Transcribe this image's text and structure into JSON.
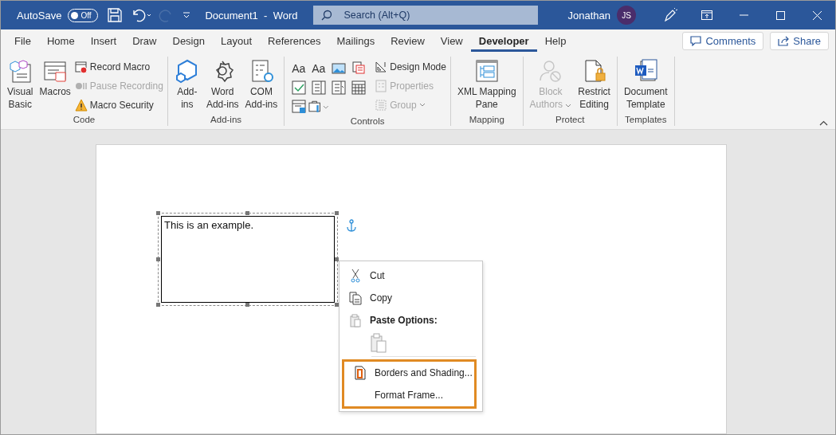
{
  "title_bar": {
    "autosave_label": "AutoSave",
    "autosave_toggle": {
      "label": "Off",
      "on": false
    },
    "document_title": "Document1  -  Word",
    "search": {
      "placeholder": "Search (Alt+Q)"
    },
    "user_name": "Jonathan",
    "avatar_initials": "JS"
  },
  "tabs": [
    {
      "label": "File",
      "selected": false
    },
    {
      "label": "Home",
      "selected": false
    },
    {
      "label": "Insert",
      "selected": false
    },
    {
      "label": "Draw",
      "selected": false
    },
    {
      "label": "Design",
      "selected": false
    },
    {
      "label": "Layout",
      "selected": false
    },
    {
      "label": "References",
      "selected": false
    },
    {
      "label": "Mailings",
      "selected": false
    },
    {
      "label": "Review",
      "selected": false
    },
    {
      "label": "View",
      "selected": false
    },
    {
      "label": "Developer",
      "selected": true
    },
    {
      "label": "Help",
      "selected": false
    }
  ],
  "header_buttons": [
    {
      "label": "Comments"
    },
    {
      "label": "Share"
    }
  ],
  "ribbon_groups": [
    {
      "label": "Code",
      "items": [
        {
          "kind": "large",
          "lines": [
            "Visual",
            "Basic"
          ],
          "disabled": false
        },
        {
          "kind": "large",
          "lines": [
            "Macros"
          ],
          "disabled": false
        },
        {
          "kind": "stack",
          "children": [
            {
              "label": "Record Macro",
              "disabled": false
            },
            {
              "label": "Pause Recording",
              "disabled": true
            },
            {
              "label": "Macro Security",
              "disabled": false
            }
          ]
        }
      ]
    },
    {
      "label": "Add-ins",
      "items": [
        {
          "kind": "large",
          "lines": [
            "Add-",
            "ins"
          ],
          "disabled": false
        },
        {
          "kind": "large",
          "lines": [
            "Word",
            "Add-ins"
          ],
          "disabled": false
        },
        {
          "kind": "large",
          "lines": [
            "COM",
            "Add-ins"
          ],
          "disabled": false
        }
      ]
    },
    {
      "label": "Controls",
      "items": [
        {
          "kind": "grid",
          "cells": [
            {
              "kind": "glyph",
              "glyph": "Aa"
            },
            {
              "kind": "glyph",
              "glyph": "Aa"
            },
            {
              "kind": "icon"
            },
            {
              "kind": "icon"
            },
            {
              "kind": "icon"
            },
            {
              "kind": "icon"
            },
            {
              "kind": "icon"
            },
            {
              "kind": "icon"
            },
            {
              "kind": "icon"
            },
            {
              "kind": "icon",
              "has_menu": true
            }
          ]
        },
        {
          "kind": "stack",
          "children": [
            {
              "label": "Design Mode",
              "disabled": false
            },
            {
              "label": "Properties",
              "disabled": true
            },
            {
              "label": "Group",
              "disabled": true,
              "has_menu": true
            }
          ]
        }
      ]
    },
    {
      "label": "Mapping",
      "items": [
        {
          "kind": "large",
          "lines": [
            "XML Mapping",
            "Pane"
          ],
          "disabled": false
        }
      ]
    },
    {
      "label": "Protect",
      "items": [
        {
          "kind": "large",
          "lines": [
            "Block",
            "Authors"
          ],
          "disabled": true,
          "has_menu": true
        },
        {
          "kind": "large",
          "lines": [
            "Restrict",
            "Editing"
          ],
          "disabled": false
        }
      ]
    },
    {
      "label": "Templates",
      "items": [
        {
          "kind": "large",
          "lines": [
            "Document",
            "Template"
          ],
          "disabled": false
        }
      ]
    }
  ],
  "document": {
    "frame_text": "This is an example."
  },
  "context_menu": [
    {
      "kind": "item",
      "label": "Cut",
      "highlighted": false
    },
    {
      "kind": "item",
      "label": "Copy",
      "highlighted": false
    },
    {
      "kind": "header",
      "label": "Paste Options:",
      "highlighted": false
    },
    {
      "kind": "paste",
      "highlighted": false
    },
    {
      "kind": "separator",
      "highlighted": false
    },
    {
      "kind": "item",
      "label": "Borders and Shading...",
      "highlighted": true
    },
    {
      "kind": "item",
      "label": "Format Frame...",
      "highlighted": true
    }
  ]
}
